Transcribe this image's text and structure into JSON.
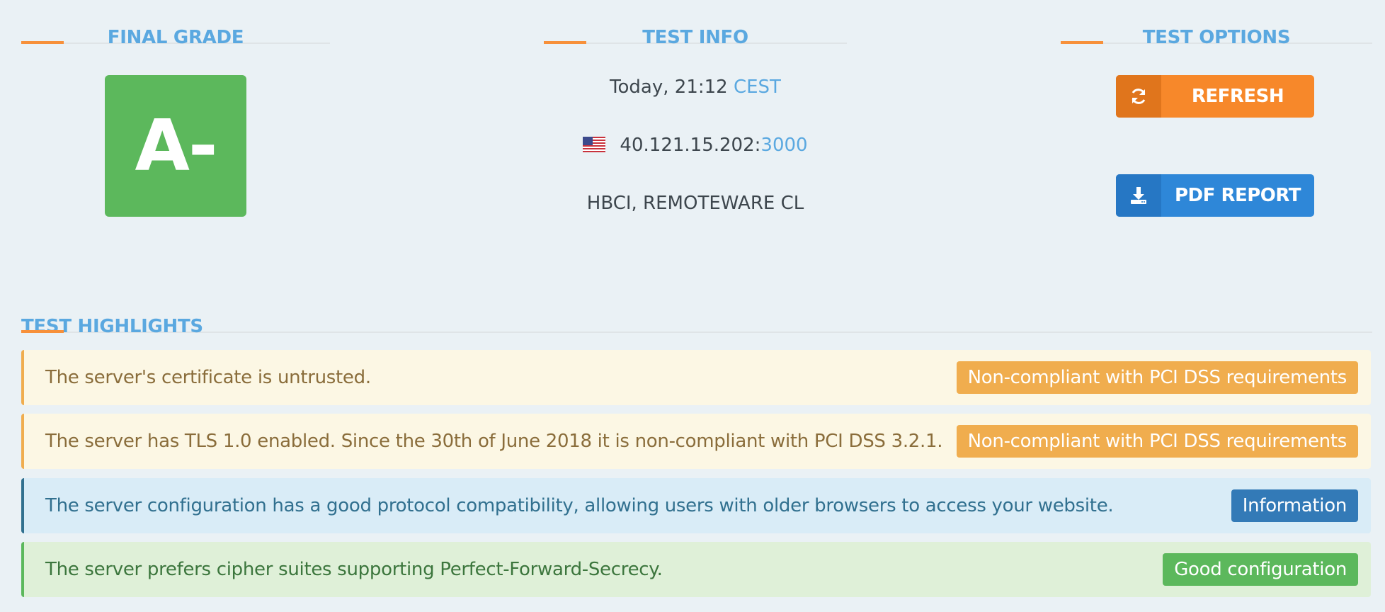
{
  "sections": {
    "final_grade": "FINAL GRADE",
    "test_info": "TEST INFO",
    "test_options": "TEST OPTIONS",
    "test_highlights": "TEST HIGHLIGHTS"
  },
  "grade": "A-",
  "test_info": {
    "date": "Today, 21:12",
    "timezone": "CEST",
    "ip": "40.121.15.202:",
    "port": "3000",
    "flag": "us-flag-icon",
    "organization": "HBCI, REMOTEWARE CL"
  },
  "options": {
    "refresh_label": "REFRESH",
    "refresh_icon": "refresh-icon",
    "pdf_label": "PDF REPORT",
    "pdf_icon": "download-icon"
  },
  "highlights": [
    {
      "text": "The server's certificate is untrusted.",
      "badge": "Non-compliant with PCI DSS requirements",
      "level": "warning"
    },
    {
      "text": "The server has TLS 1.0 enabled. Since the 30th of June 2018 it is non-compliant with PCI DSS 3.2.1.",
      "badge": "Non-compliant with PCI DSS requirements",
      "level": "warning"
    },
    {
      "text": "The server configuration has a good protocol compatibility, allowing users with older browsers to access your website.",
      "badge": "Information",
      "level": "info"
    },
    {
      "text": "The server prefers cipher suites supporting Perfect-Forward-Secrecy.",
      "badge": "Good configuration",
      "level": "good"
    }
  ],
  "colors": {
    "accent": "#f7903a",
    "heading": "#5aa8e0",
    "grade": "#5cb85c",
    "refresh": "#f7882a",
    "pdf": "#2e87d8",
    "warning": "#f0ad4e",
    "info": "#337ab7",
    "good": "#5cb85c"
  }
}
